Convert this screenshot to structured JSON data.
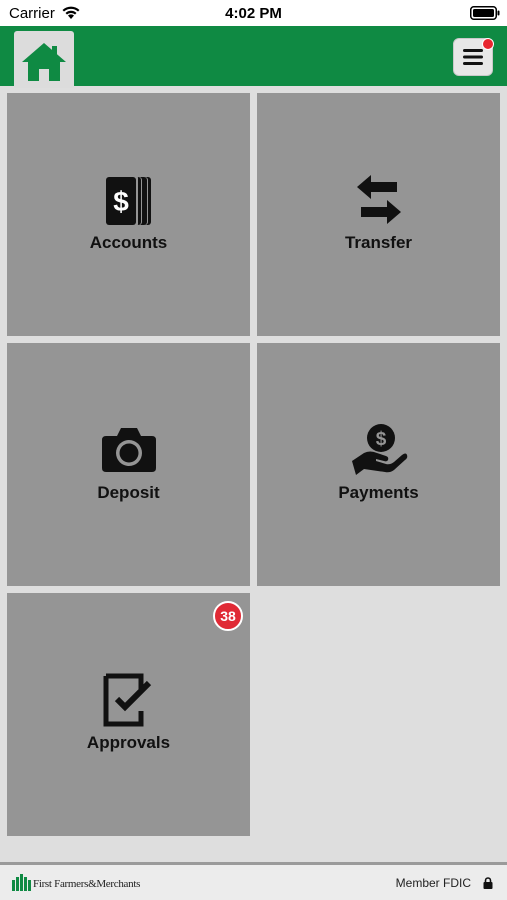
{
  "status_bar": {
    "carrier": "Carrier",
    "time": "4:02 PM"
  },
  "header": {
    "home_icon": "home-icon",
    "menu_icon": "hamburger-menu-icon",
    "brand_color": "#0f8a43",
    "notification_color": "#e8262f"
  },
  "tiles": [
    {
      "label": "Accounts",
      "icon": "dollar-bills-icon"
    },
    {
      "label": "Transfer",
      "icon": "transfer-arrows-icon"
    },
    {
      "label": "Deposit",
      "icon": "camera-icon"
    },
    {
      "label": "Payments",
      "icon": "hand-coin-icon"
    },
    {
      "label": "Approvals",
      "icon": "checklist-icon",
      "badge": "38"
    }
  ],
  "footer": {
    "logo_text": "First Farmers&Merchants",
    "fdic_text": "Member FDIC",
    "lock_icon": "lock-icon"
  }
}
